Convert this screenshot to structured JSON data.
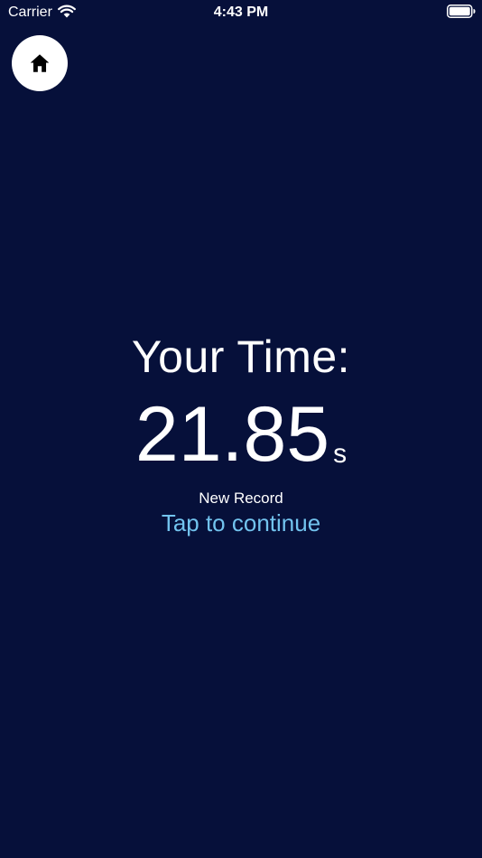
{
  "status_bar": {
    "carrier": "Carrier",
    "time": "4:43 PM",
    "icons": [
      "wifi-icon",
      "battery-icon"
    ]
  },
  "home_button": {
    "icon": "home-icon"
  },
  "result": {
    "title": "Your Time:",
    "time_value": "21.85",
    "time_unit": "s",
    "record_label": "New Record",
    "continue_label": "Tap to continue"
  },
  "colors": {
    "background": "#06103a",
    "text": "#ffffff",
    "accent": "#72c3ee"
  }
}
